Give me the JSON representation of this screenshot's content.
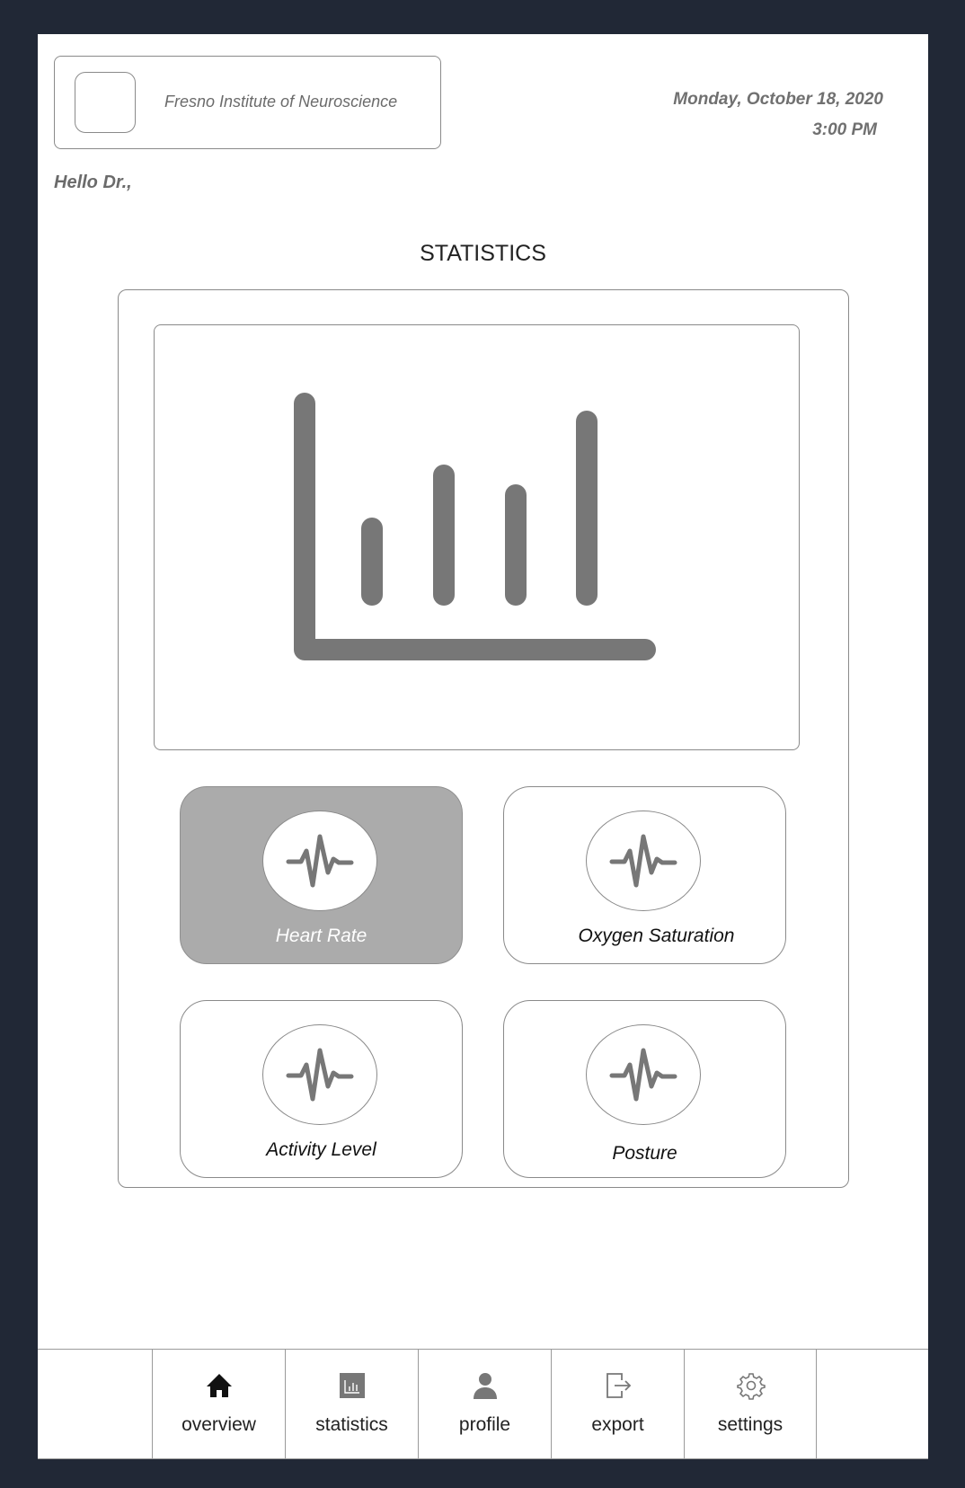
{
  "header": {
    "institution": "Fresno Institute of Neuroscience",
    "date": "Monday, October 18, 2020",
    "time": "3:00 PM",
    "greeting": "Hello Dr.,"
  },
  "main": {
    "section_title": "STATISTICS",
    "chart_icon": "bar-chart-icon",
    "metrics": [
      {
        "label": "Heart Rate",
        "icon": "pulse-icon",
        "selected": true
      },
      {
        "label": "Oxygen Saturation",
        "icon": "pulse-icon",
        "selected": false
      },
      {
        "label": "Activity Level",
        "icon": "pulse-icon",
        "selected": false
      },
      {
        "label": "Posture",
        "icon": "pulse-icon",
        "selected": false
      }
    ]
  },
  "nav": {
    "items": [
      {
        "label": "overview",
        "icon": "home-icon"
      },
      {
        "label": "statistics",
        "icon": "bar-chart-icon"
      },
      {
        "label": "profile",
        "icon": "user-icon"
      },
      {
        "label": "export",
        "icon": "export-icon"
      },
      {
        "label": "settings",
        "icon": "gear-icon"
      }
    ]
  },
  "colors": {
    "frame": "#212836",
    "icon_gray": "#777777",
    "selected_card": "#ababab"
  }
}
